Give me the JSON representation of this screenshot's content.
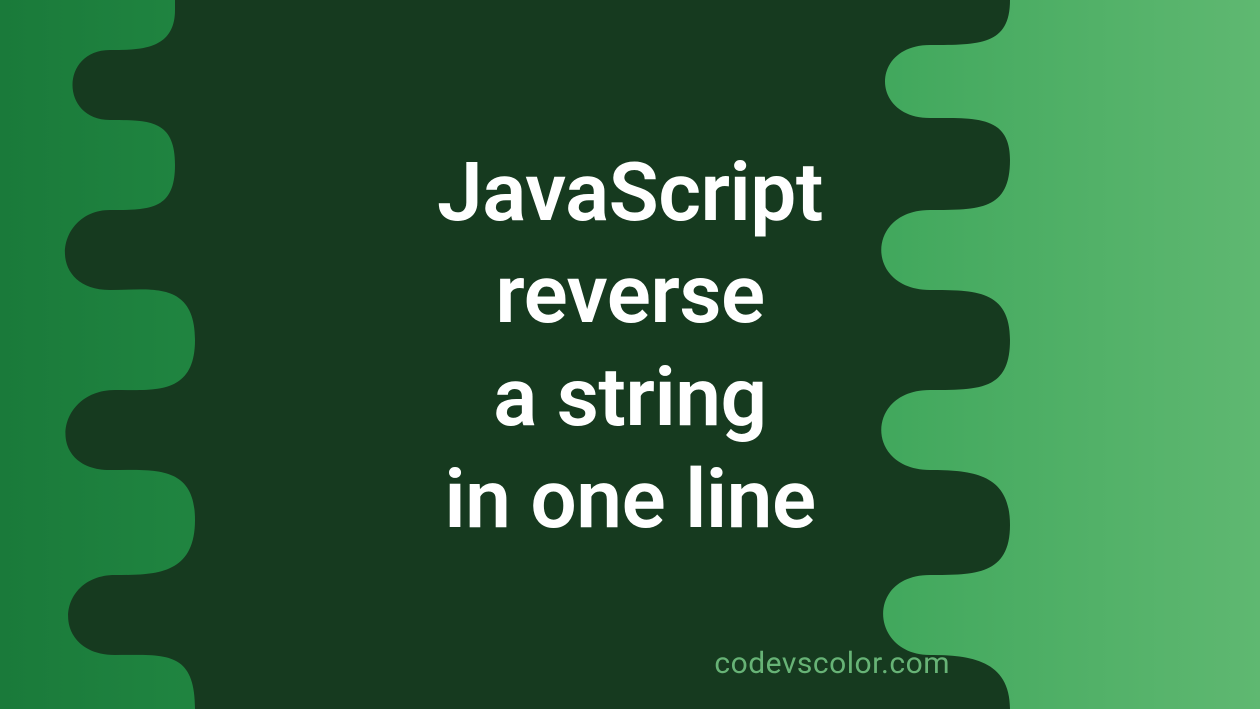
{
  "title": {
    "line1": "JavaScript",
    "line2": "reverse",
    "line3": "a string",
    "line4": "in one line"
  },
  "watermark": "codevscolor.com",
  "colors": {
    "bg_left": "#1a7a3a",
    "bg_mid": "#2d9d4f",
    "bg_right": "#5fb871",
    "blob": "#163a1f",
    "text": "#ffffff",
    "watermark": "#67b376"
  }
}
